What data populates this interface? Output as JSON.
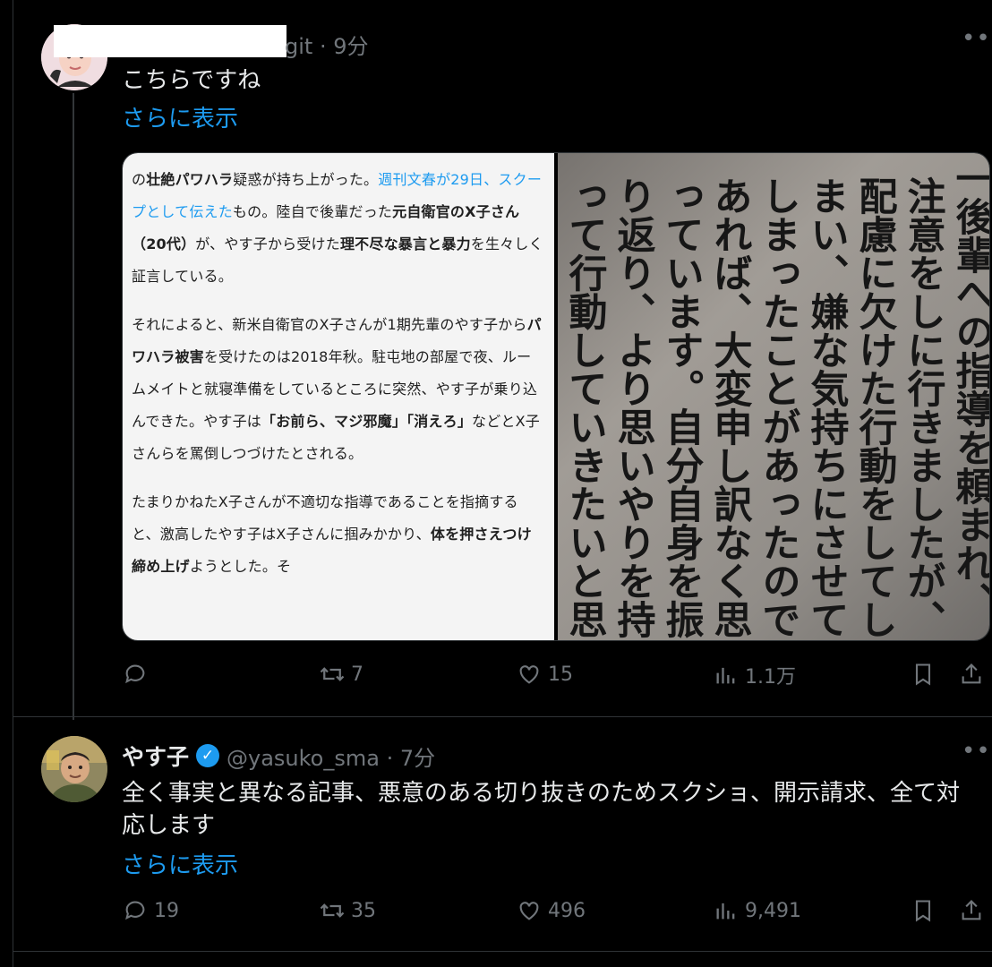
{
  "tweets": [
    {
      "meta": "git · 9分",
      "text": "こちらですね",
      "show_more": "さらに表示",
      "image_left": [
        {
          "html": "の<b>壮絶パワハラ</b>疑惑が持ち上がった。<span class=\"link\">週刊文春が29日、スクープとして伝えた</span>もの。陸自で後輩だった<b>元自衛官のX子さん（20代）</b>が、やす子から受けた<b>理不尽な暴言と暴力</b>を生々しく証言している。"
        },
        {
          "html": "それによると、新米自衛官のX子さんが1期先輩のやす子から<b>パワハラ被害</b>を受けたのは2018年秋。駐屯地の部屋で夜、ルームメイトと就寝準備をしているところに突然、やす子が乗り込んできた。やす子は<b>「お前ら、マジ邪魔」「消えろ」</b>などとX子さんらを罵倒しつづけたとされる。"
        },
        {
          "html": "たまりかねたX子さんが不適切な指導であることを指摘すると、激高したやす子はX子さんに掴みかかり、<b>体を押さえつけ締め上げ</b>ようとした。そ"
        }
      ],
      "image_right_columns": [
        "一後輩への指導を頼まれ、",
        "注意をしに行きましたが、",
        "配慮に欠けた行動をしてし",
        "まい、嫌な気持ちにさせて",
        "しまったことがあったので",
        "あれば、大変申し訳なく思",
        "っています。自分自身を振",
        "り返り、より思いやりを持",
        "って行動していきたいと思"
      ],
      "actions": {
        "reply": "",
        "retweet": "7",
        "like": "15",
        "views": "1.1万"
      }
    },
    {
      "name": "やす子",
      "handle": "@yasuko_sma · 7分",
      "text": "全く事実と異なる記事、悪意のある切り抜きのためスクショ、開示請求、全て対応します",
      "show_more": "さらに表示",
      "actions": {
        "reply": "19",
        "retweet": "35",
        "like": "496",
        "views": "9,491"
      }
    }
  ],
  "icons": {
    "reply": "reply-icon",
    "retweet": "retweet-icon",
    "like": "heart-icon",
    "views": "views-icon",
    "bookmark": "bookmark-icon",
    "share": "share-icon",
    "verified": "verified-badge-icon"
  },
  "colors": {
    "background": "#000000",
    "text": "#e7e9ea",
    "muted": "#71767b",
    "accent": "#1d9bf0"
  }
}
